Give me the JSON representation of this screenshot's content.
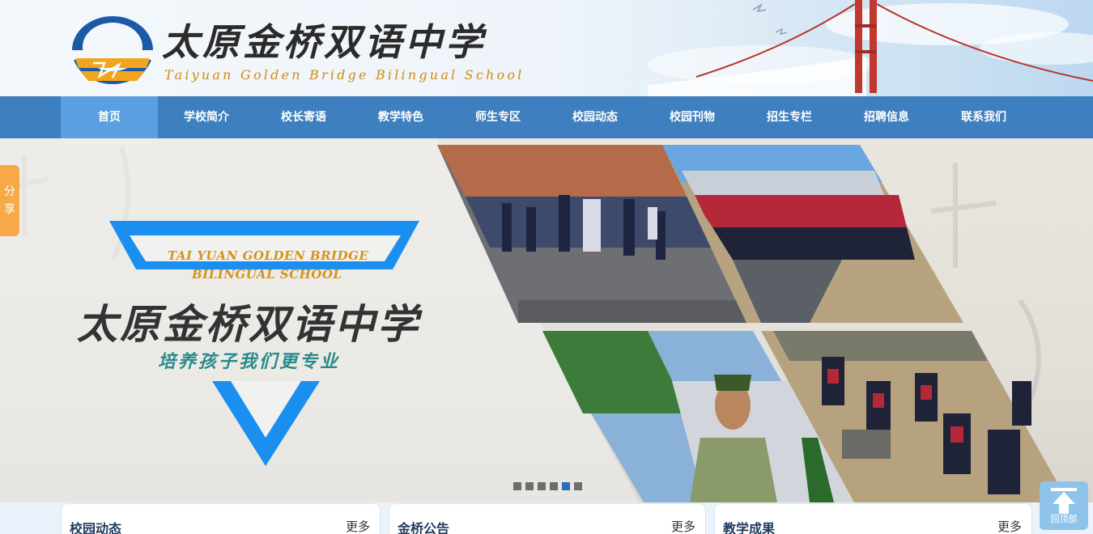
{
  "header": {
    "name_zh": "太原金桥双语中学",
    "name_en": "Taiyuan Golden Bridge Bilingual School"
  },
  "nav": {
    "items": [
      "首页",
      "学校简介",
      "校长寄语",
      "教学特色",
      "师生专区",
      "校园动态",
      "校园刊物",
      "招生专栏",
      "招聘信息",
      "联系我们"
    ],
    "active_index": 0
  },
  "banner": {
    "en_line1": "TAI YUAN GOLDEN BRIDGE",
    "en_line2": "BILINGUAL SCHOOL",
    "title": "太原金桥双语中学",
    "slogan": "培养孩子我们更专业",
    "slide_count": 6,
    "active_slide": 4
  },
  "share": {
    "label_1": "分",
    "label_2": "享"
  },
  "back_to_top": {
    "label": "回顶部"
  },
  "panels": [
    {
      "title": "校园动态",
      "more": "更多"
    },
    {
      "title": "金桥公告",
      "more": "更多"
    },
    {
      "title": "教学成果",
      "more": "更多"
    }
  ],
  "colors": {
    "nav_bg": "#3d7fbf",
    "nav_active": "#5a9fdf",
    "accent_orange": "#f7a94a",
    "triangle_blue": "#1a8ff0"
  }
}
